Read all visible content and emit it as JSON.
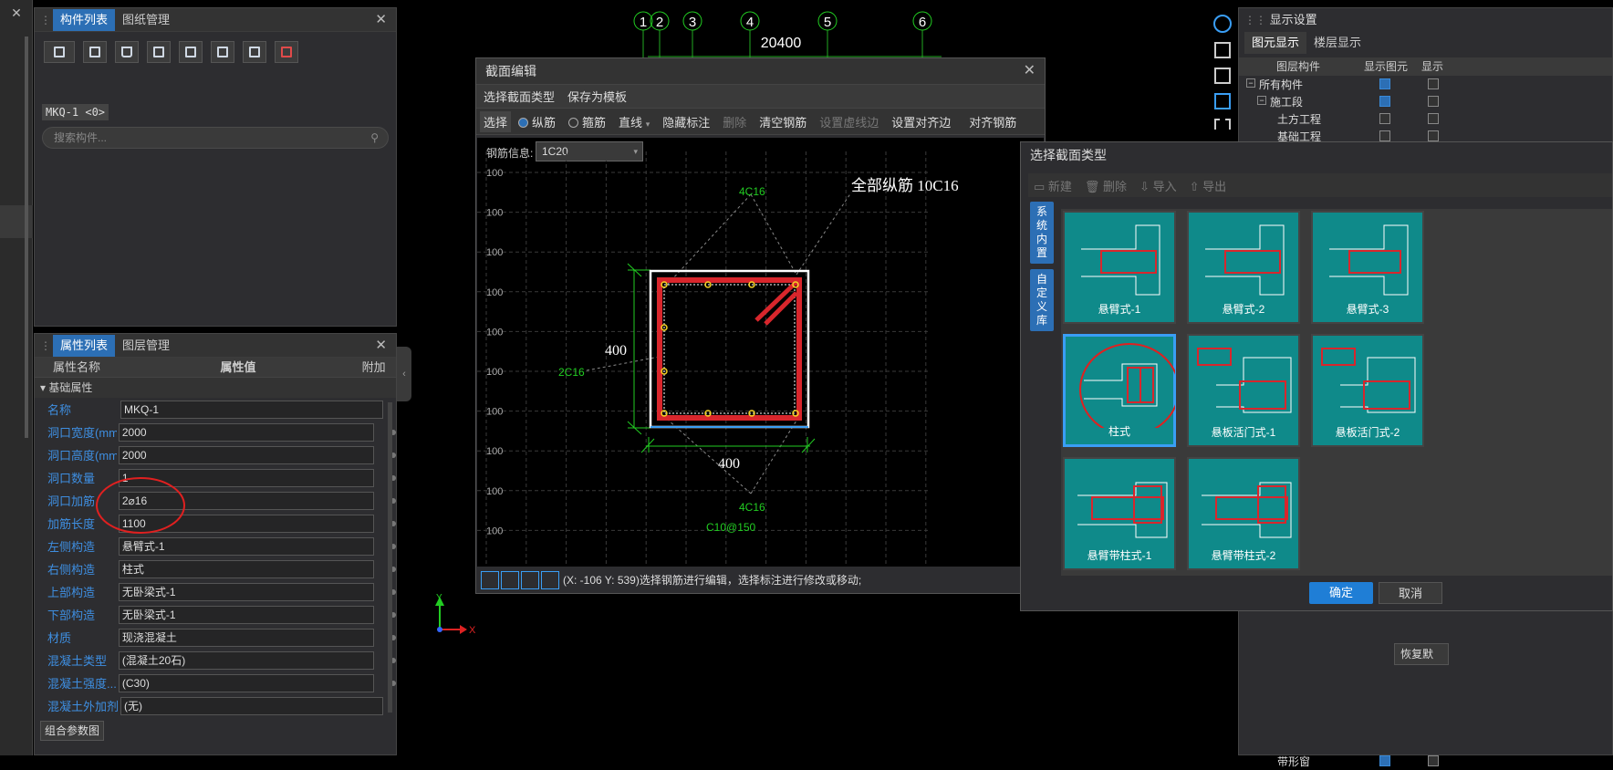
{
  "left_panel_top": {
    "tabs": [
      "构件列表",
      "图纸管理"
    ],
    "search_placeholder": "搜索构件...",
    "component_chip": "MKQ-1 <0>"
  },
  "props_panel": {
    "tabs": [
      "属性列表",
      "图层管理"
    ],
    "headers": {
      "name": "属性名称",
      "value": "属性值",
      "extra": "附加"
    },
    "group": "基础属性",
    "rows": [
      {
        "name": "名称",
        "value": "MKQ-1",
        "dot": false
      },
      {
        "name": "洞口宽度(mm)",
        "value": "2000",
        "dot": true
      },
      {
        "name": "洞口高度(mm)",
        "value": "2000",
        "dot": true
      },
      {
        "name": "洞口数量",
        "value": "1",
        "dot": true
      },
      {
        "name": "洞口加筋",
        "value": "2⌀16",
        "dot": true
      },
      {
        "name": "加筋长度",
        "value": "1100",
        "dot": true
      },
      {
        "name": "左侧构造",
        "value": "悬臂式-1",
        "dot": true
      },
      {
        "name": "右侧构造",
        "value": "柱式",
        "dot": true
      },
      {
        "name": "上部构造",
        "value": "无卧梁式-1",
        "dot": true
      },
      {
        "name": "下部构造",
        "value": "无卧梁式-1",
        "dot": true
      },
      {
        "name": "材质",
        "value": "现浇混凝土",
        "dot": true
      },
      {
        "name": "混凝土类型",
        "value": "(混凝土20石)",
        "dot": true
      },
      {
        "name": "混凝土强度...",
        "value": "(C30)",
        "dot": true
      },
      {
        "name": "混凝土外加剂",
        "value": "(无)",
        "dot": false
      }
    ],
    "bottom_button": "组合参数图"
  },
  "axis": {
    "labels": [
      "1",
      "2",
      "3",
      "4",
      "5",
      "6"
    ],
    "total": "20400"
  },
  "section_editor": {
    "title": "截面编辑",
    "menu": [
      "选择截面类型",
      "保存为模板"
    ],
    "toolbar": {
      "select": "选择",
      "radio_long": "纵筋",
      "radio_stirrup": "箍筋",
      "line": "直线",
      "hide_label": "隐藏标注",
      "delete": "删除",
      "clear": "清空钢筋",
      "set_dash": "设置虚线边",
      "set_align": "设置对齐边",
      "align_bar": "对齐钢筋"
    },
    "rebar_info_label": "钢筋信息:",
    "rebar_info_value": "1C20",
    "grid_label": "100",
    "annotations": {
      "all_long": "全部纵筋  10C16",
      "top": "4C16",
      "bottom": "4C16",
      "left": "2C16",
      "stirrup": "C10@150",
      "dim_h": "400",
      "dim_v": "400"
    },
    "status": "(X: -106 Y: 539)选择钢筋进行编辑，选择标注进行修改或移动;"
  },
  "section_type_dialog": {
    "title": "选择截面类型",
    "toolbar": [
      "新建",
      "删除",
      "导入",
      "导出"
    ],
    "side_tabs": [
      "系统内置",
      "自定义库"
    ],
    "cards": [
      "悬臂式-1",
      "悬臂式-2",
      "悬臂式-3",
      "柱式",
      "悬板活门式-1",
      "悬板活门式-2",
      "悬臂带柱式-1",
      "悬臂带柱式-2"
    ],
    "ok": "确定",
    "cancel": "取消"
  },
  "display_panel": {
    "title": "显示设置",
    "tabs": [
      "图元显示",
      "楼层显示"
    ],
    "headers": [
      "图层构件",
      "显示图元",
      "显示"
    ],
    "rows": [
      {
        "label": "所有构件",
        "checked": true
      },
      {
        "label": "施工段",
        "checked": true
      },
      {
        "label": "土方工程",
        "checked": false
      },
      {
        "label": "基础工程",
        "checked": false
      }
    ],
    "bottom_row": {
      "label": "带形窗",
      "checked": true
    },
    "restore_button": "恢复默"
  },
  "ucs": {
    "y": "Y",
    "x": "X"
  },
  "colors": {
    "accent": "#2c6fb5",
    "teal": "#0f8a8a",
    "rebar": "#d8262c",
    "green": "#22cc22"
  }
}
